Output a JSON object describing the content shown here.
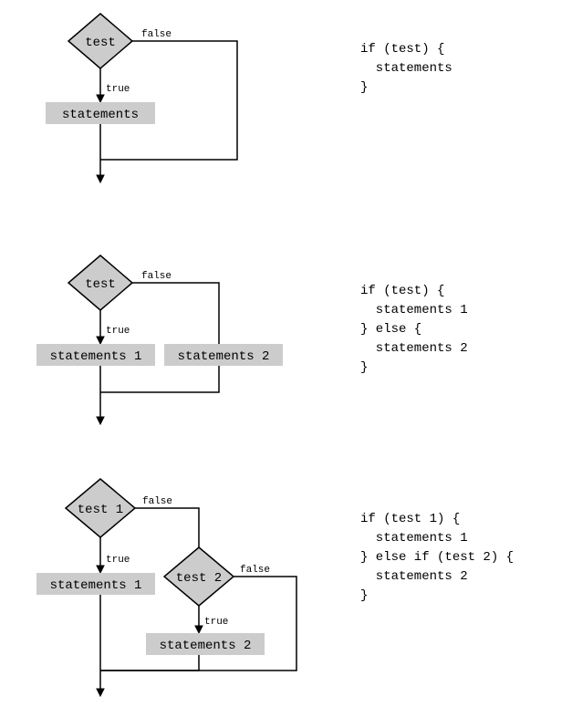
{
  "diagrams": [
    {
      "test_label": "test",
      "true_label": "true",
      "false_label": "false",
      "statements_label": "statements",
      "code": "if (test) {\n  statements\n}"
    },
    {
      "test_label": "test",
      "true_label": "true",
      "false_label": "false",
      "statements1_label": "statements 1",
      "statements2_label": "statements 2",
      "code": "if (test) {\n  statements 1\n} else {\n  statements 2\n}"
    },
    {
      "test1_label": "test 1",
      "test2_label": "test 2",
      "true_label": "true",
      "false_label": "false",
      "statements1_label": "statements 1",
      "statements2_label": "statements 2",
      "code": "if (test 1) {\n  statements 1\n} else if (test 2) {\n  statements 2\n}"
    }
  ]
}
